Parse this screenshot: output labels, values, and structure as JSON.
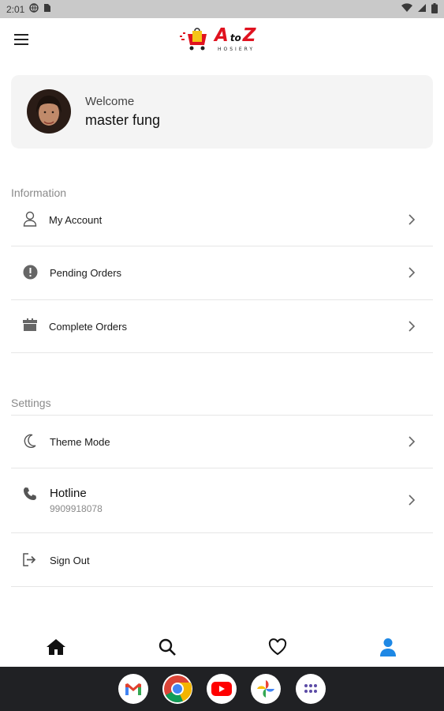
{
  "status_bar": {
    "time": "2:01"
  },
  "app_bar": {
    "logo_main": "A",
    "logo_to": "to",
    "logo_end": "Z",
    "logo_sub": "HOSIERY"
  },
  "profile": {
    "welcome": "Welcome",
    "name": "master fung"
  },
  "information": {
    "title": "Information",
    "items": [
      {
        "label": "My Account",
        "icon": "person-outline-icon"
      },
      {
        "label": "Pending Orders",
        "icon": "alert-circle-icon"
      },
      {
        "label": "Complete Orders",
        "icon": "gift-box-icon"
      }
    ]
  },
  "settings": {
    "title": "Settings",
    "theme_mode": "Theme Mode",
    "hotline_title": "Hotline",
    "hotline_number": "9909918078",
    "sign_out": "Sign Out"
  },
  "bottom_nav": {
    "active": "profile",
    "active_color": "#1e88e5",
    "items": [
      "home-icon",
      "search-icon",
      "heart-icon",
      "profile-icon"
    ]
  },
  "dock": {
    "apps": [
      "gmail-icon",
      "chrome-icon",
      "youtube-icon",
      "photos-icon",
      "app-drawer-icon"
    ]
  }
}
